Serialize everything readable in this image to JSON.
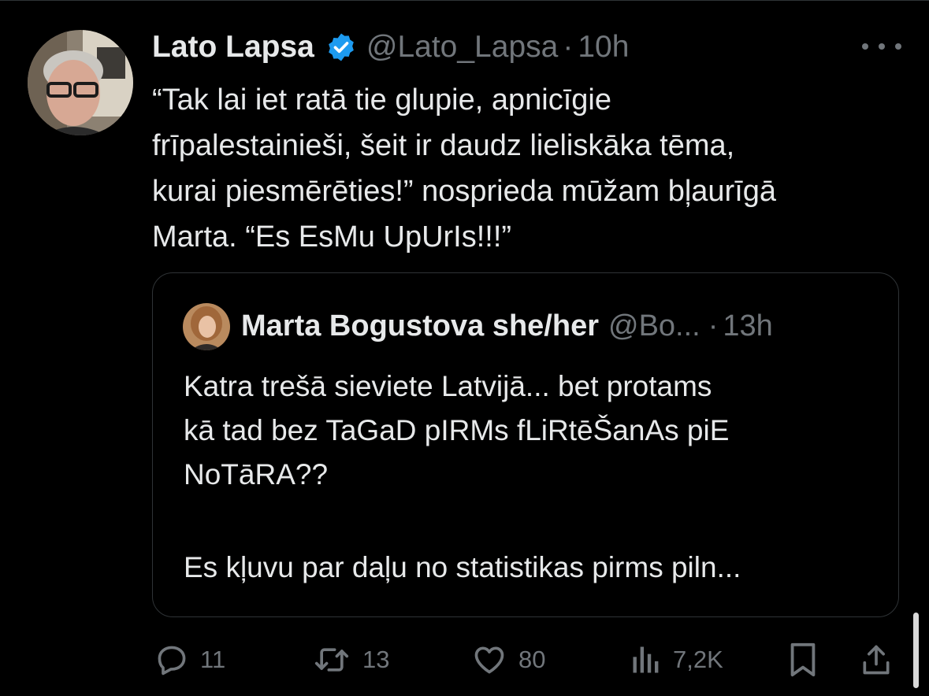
{
  "tweet": {
    "author_name": "Lato Lapsa",
    "handle": "@Lato_Lapsa",
    "separator": "·",
    "time": "10h",
    "text_lines": [
      "“Tak lai iet ratā tie glupie, apnicīgie",
      "frīpalestainieši, šeit ir daudz lieliskāka tēma,",
      "kurai piesmērēties!” nosprieda mūžam bļaurīgā",
      "Marta. “Es EsMu UpUrIs!!!”"
    ]
  },
  "quote": {
    "author_name": "Marta Bogustova she/her",
    "handle": "@Bo...",
    "separator": "·",
    "time": "13h",
    "text_lines": [
      "Katra trešā sieviete Latvijā... bet protams",
      "kā tad bez TaGaD pIRMs fLiRtēŠanAs piE",
      "NoTāRA??",
      "",
      "Es kļuvu par daļu no statistikas pirms piln..."
    ]
  },
  "actions": {
    "reply": {
      "icon": "reply-icon",
      "count": "11"
    },
    "retweet": {
      "icon": "retweet-icon",
      "count": "13"
    },
    "like": {
      "icon": "heart-icon",
      "count": "80"
    },
    "views": {
      "icon": "views-icon",
      "count": "7,2K"
    },
    "bookmark": {
      "icon": "bookmark-icon"
    },
    "share": {
      "icon": "share-icon"
    }
  },
  "colors": {
    "background": "#000000",
    "text": "#e7e9ea",
    "secondary": "#71767b",
    "border": "#2f3336",
    "verified": "#1d9bf0"
  }
}
